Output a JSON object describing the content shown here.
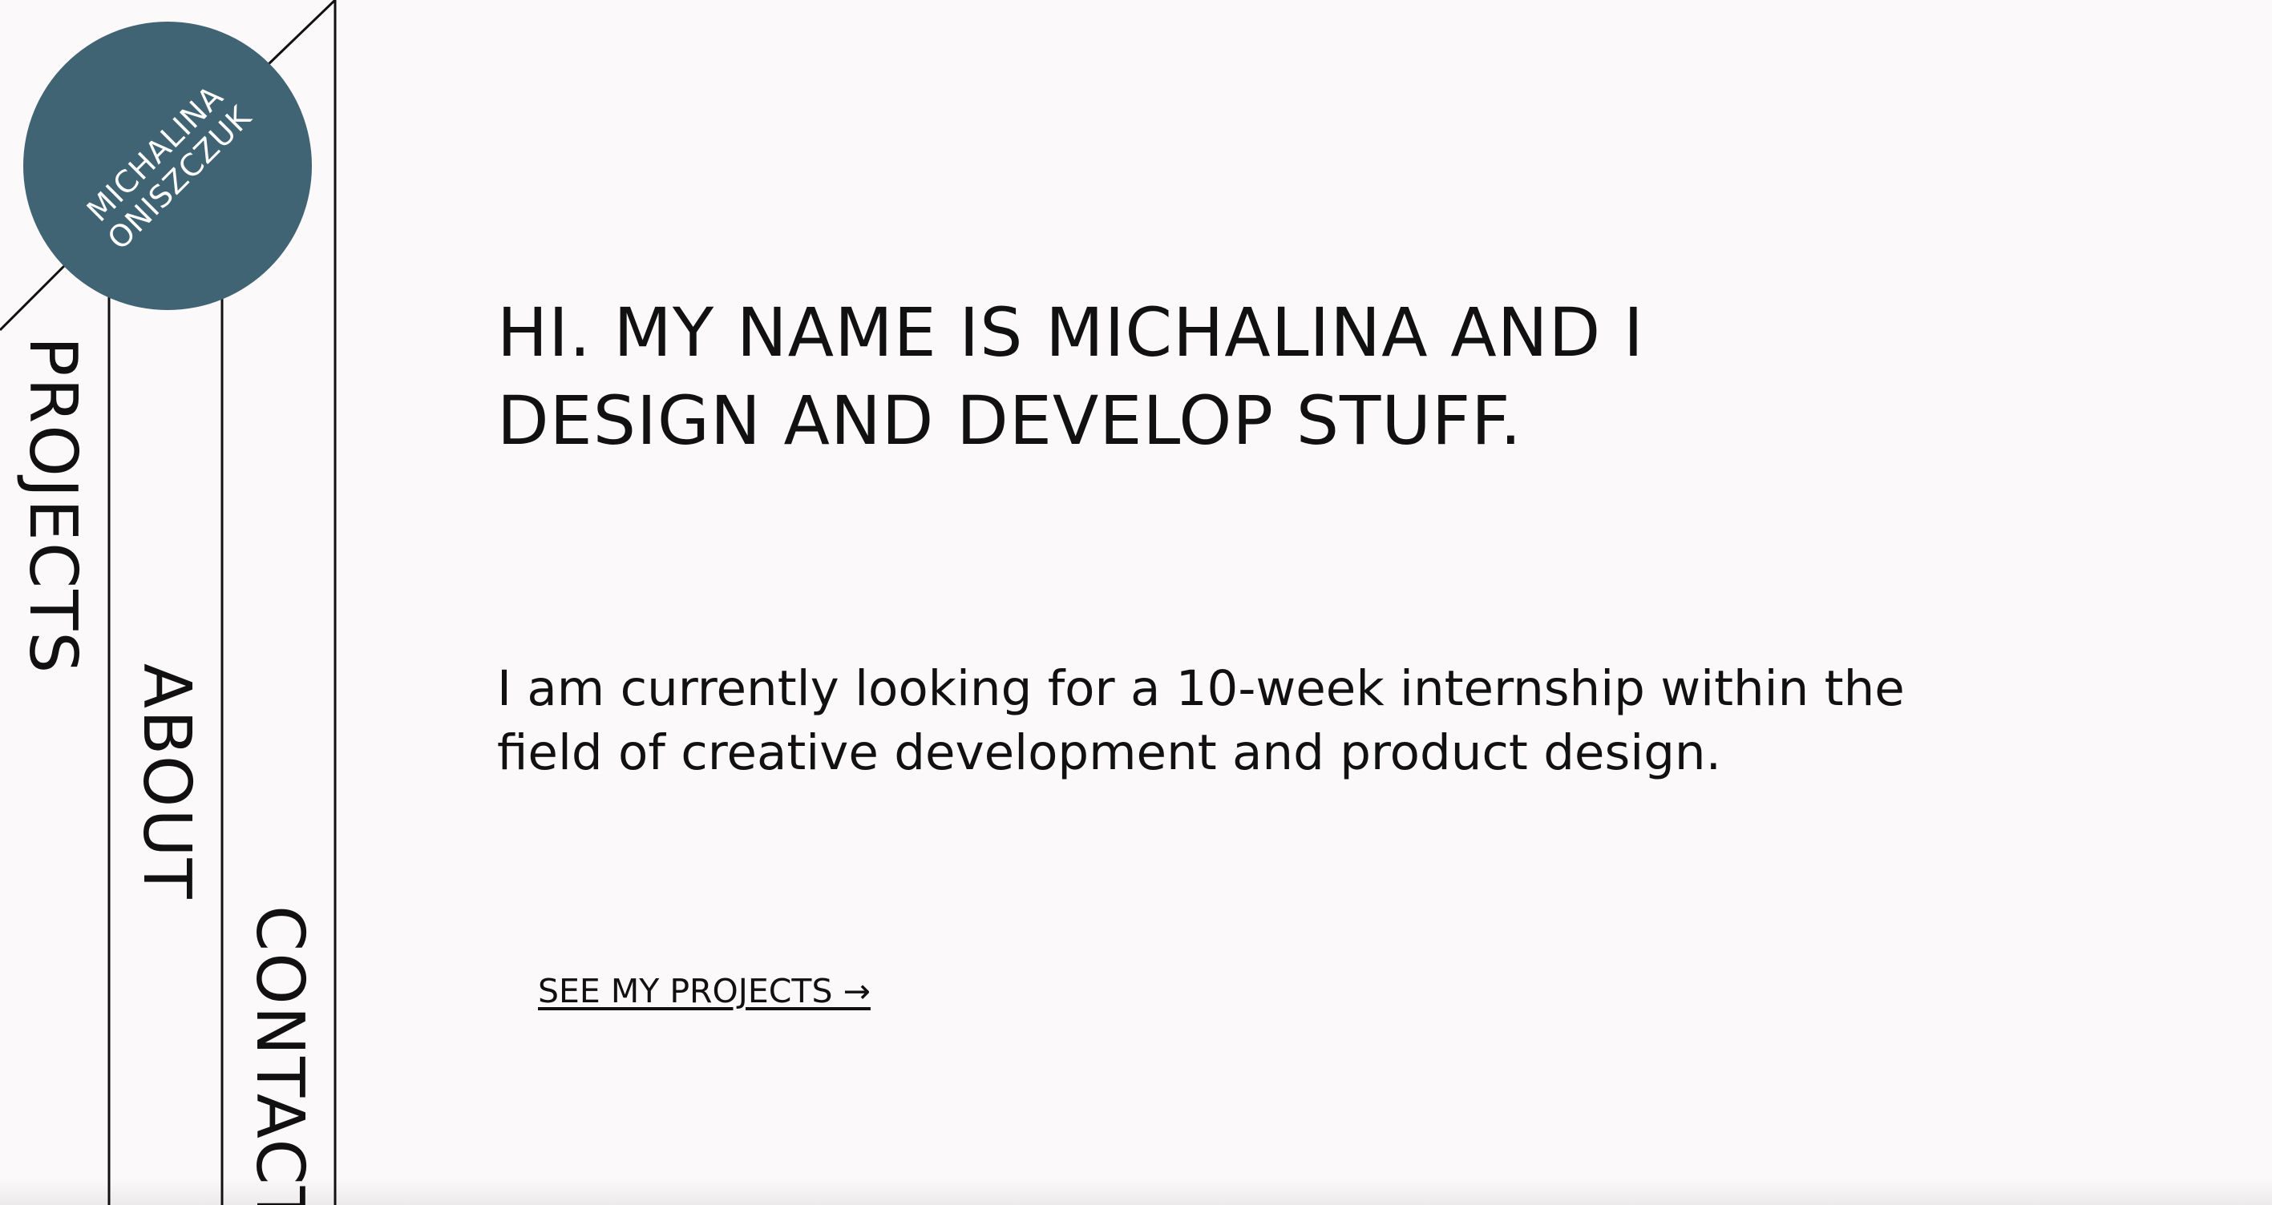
{
  "logo": {
    "line1": "MICHALINA",
    "line2": "ONISZCZUK",
    "color": "#406474"
  },
  "nav": {
    "projects": "PROJECTS",
    "about": "ABOUT",
    "contact": "CONTACT"
  },
  "hero": {
    "headline_line1": "HI. MY NAME IS MICHALINA AND I",
    "headline_line2": "DESIGN AND DEVELOP STUFF.",
    "intro_line1": "I am currently looking for a 10-week internship within the",
    "intro_line2": "field of creative development and product design.",
    "cta_label": "SEE MY PROJECTS →"
  },
  "colors": {
    "background": "#fbf9fa",
    "text": "#111111",
    "accent": "#406474"
  }
}
